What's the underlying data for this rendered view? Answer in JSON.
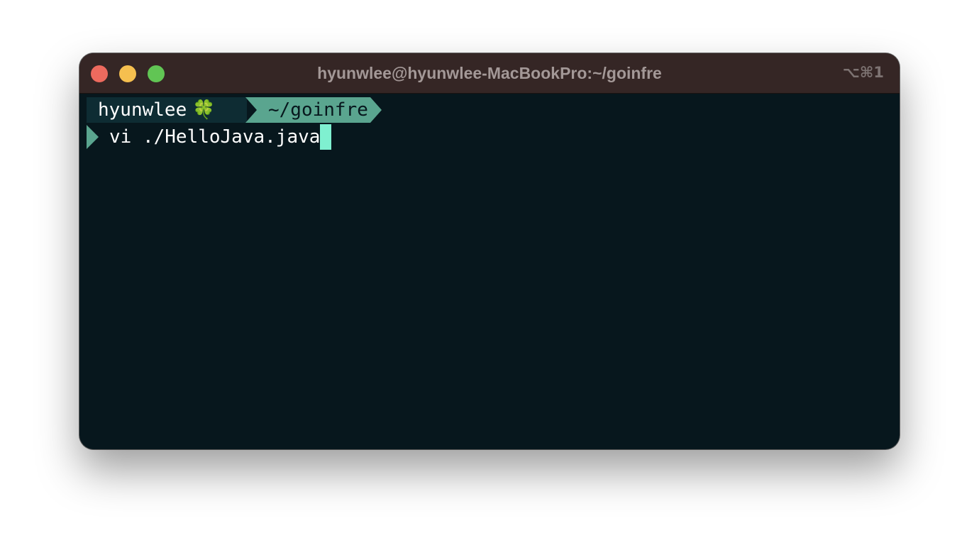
{
  "window": {
    "title": "hyunwlee@hyunwlee-MacBookPro:~/goinfre",
    "shortcut": "⌥⌘1",
    "traffic_lights": {
      "close_color": "#ed6a5e",
      "minimize_color": "#f5bf4f",
      "zoom_color": "#61c554"
    }
  },
  "terminal": {
    "prompt": {
      "user": "hyunwlee",
      "emoji": "🍀",
      "path": "~/goinfre",
      "prompt_icon": "chevron-right-icon"
    },
    "command": "vi ./HelloJava.java",
    "colors": {
      "background": "#07171d",
      "accent": "#5aa58f",
      "cursor": "#7ff0d0"
    }
  }
}
